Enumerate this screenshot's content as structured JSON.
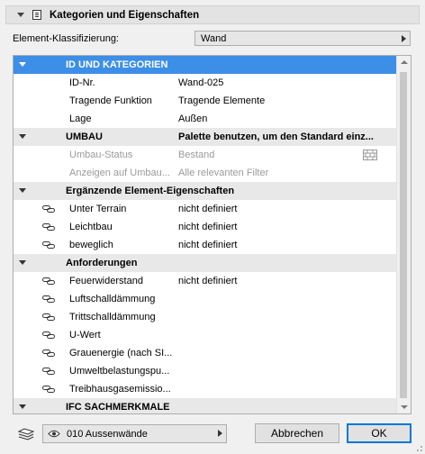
{
  "panel": {
    "title": "Kategorien und Eigenschaften",
    "classification_label": "Element-Klassifizierung:",
    "classification_value": "Wand"
  },
  "tree": {
    "rows": [
      {
        "type": "section",
        "label": "ID UND KATEGORIEN",
        "value": "",
        "selected": true
      },
      {
        "type": "prop",
        "label": "ID-Nr.",
        "value": "Wand-025"
      },
      {
        "type": "prop",
        "label": "Tragende Funktion",
        "value": "Tragende Elemente"
      },
      {
        "type": "prop",
        "label": "Lage",
        "value": "Außen"
      },
      {
        "type": "section",
        "label": "UMBAU",
        "value": "Palette benutzen, um den Standard einz..."
      },
      {
        "type": "prop",
        "label": "Umbau-Status",
        "value": "Bestand",
        "disabled": true,
        "icon": "brick-wall-icon"
      },
      {
        "type": "prop",
        "label": "Anzeigen auf Umbau...",
        "value": "Alle relevanten Filter",
        "disabled": true
      },
      {
        "type": "section",
        "label": "Ergänzende Element-Eigenschaften",
        "value": ""
      },
      {
        "type": "prop",
        "label": "Unter Terrain",
        "value": "nicht definiert",
        "icon": "link-icon"
      },
      {
        "type": "prop",
        "label": "Leichtbau",
        "value": "nicht definiert",
        "icon": "link-icon"
      },
      {
        "type": "prop",
        "label": "beweglich",
        "value": "nicht definiert",
        "icon": "link-icon"
      },
      {
        "type": "section",
        "label": "Anforderungen",
        "value": ""
      },
      {
        "type": "prop",
        "label": "Feuerwiderstand",
        "value": "nicht definiert",
        "icon": "link-icon"
      },
      {
        "type": "prop",
        "label": "Luftschalldämmung",
        "value": "",
        "icon": "link-icon"
      },
      {
        "type": "prop",
        "label": "Trittschalldämmung",
        "value": "",
        "icon": "link-icon"
      },
      {
        "type": "prop",
        "label": "U-Wert",
        "value": "",
        "icon": "link-icon"
      },
      {
        "type": "prop",
        "label": "Grauenergie (nach SI...",
        "value": "",
        "icon": "link-icon"
      },
      {
        "type": "prop",
        "label": "Umweltbelastungspu...",
        "value": "",
        "icon": "link-icon"
      },
      {
        "type": "prop",
        "label": "Treibhausgasemissio...",
        "value": "",
        "icon": "link-icon"
      },
      {
        "type": "section",
        "label": "IFC SACHMERKMALE",
        "value": "",
        "collapsed": true
      }
    ]
  },
  "footer": {
    "layer_value": "010 Aussenwände",
    "cancel_label": "Abbrechen",
    "ok_label": "OK"
  },
  "colors": {
    "selection": "#3d8ee6",
    "section_bg": "#e8e8e8",
    "disabled_text": "#9a9a9a"
  }
}
